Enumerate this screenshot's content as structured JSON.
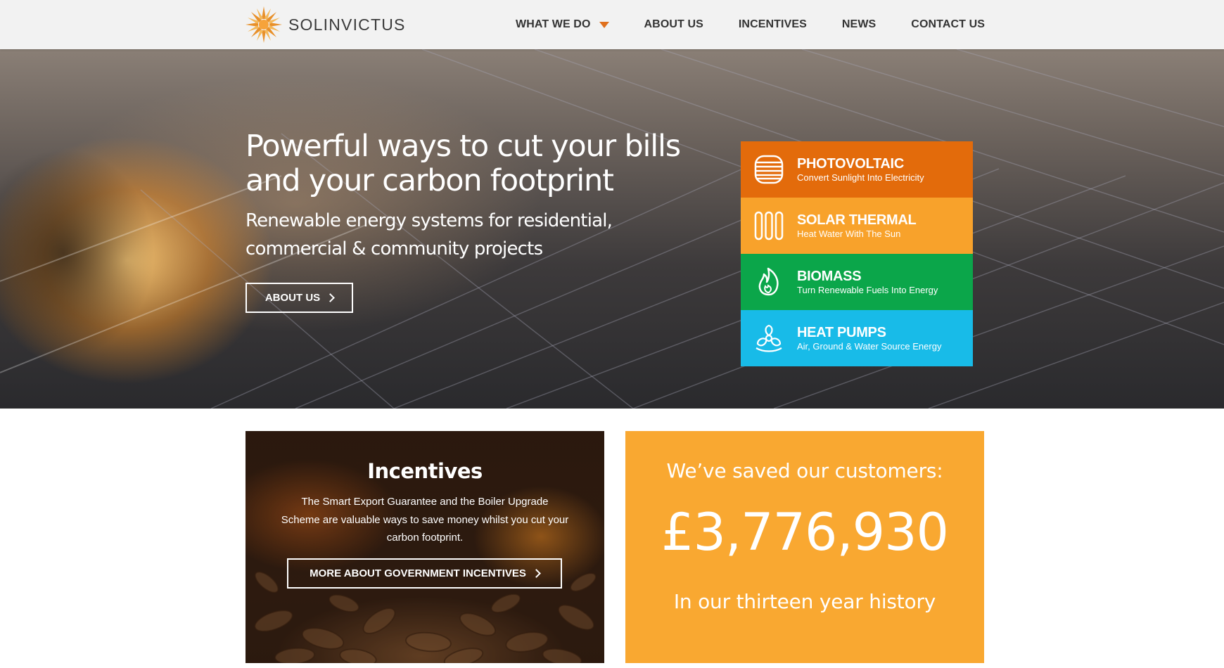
{
  "brand": {
    "name": "SOLINVICTUS",
    "logo_icon": "sun-logo-icon"
  },
  "nav": {
    "items": [
      {
        "label": "WHAT WE DO",
        "has_dropdown": true
      },
      {
        "label": "ABOUT US"
      },
      {
        "label": "INCENTIVES"
      },
      {
        "label": "NEWS"
      },
      {
        "label": "CONTACT US"
      }
    ],
    "accent_color": "#e0701d"
  },
  "hero": {
    "title": "Powerful ways to cut your bills and your carbon footprint",
    "subtitle": "Renewable energy systems for residential, commercial & community projects",
    "button_label": "ABOUT US"
  },
  "services": [
    {
      "title": "PHOTOVOLTAIC",
      "description": "Convert Sunlight Into Electricity",
      "color": "#e36b0b",
      "icon": "solar-panel-icon"
    },
    {
      "title": "SOLAR THERMAL",
      "description": "Heat Water With The Sun",
      "color": "#f8a22b",
      "icon": "tubes-icon"
    },
    {
      "title": "BIOMASS",
      "description": "Turn Renewable Fuels Into Energy",
      "color": "#0ba64a",
      "icon": "flame-icon"
    },
    {
      "title": "HEAT PUMPS",
      "description": "Air, Ground & Water Source Energy",
      "color": "#18bbe8",
      "icon": "fan-icon"
    }
  ],
  "incentives": {
    "title": "Incentives",
    "text": "The Smart Export Guarantee and the Boiler Upgrade Scheme are valuable ways to save money whilst you cut your carbon footprint.",
    "button_label": "MORE ABOUT GOVERNMENT INCENTIVES"
  },
  "savings": {
    "title": "We’ve saved our customers:",
    "amount": "£3,776,930",
    "footer": "In our thirteen year history",
    "color": "#f9a831"
  }
}
